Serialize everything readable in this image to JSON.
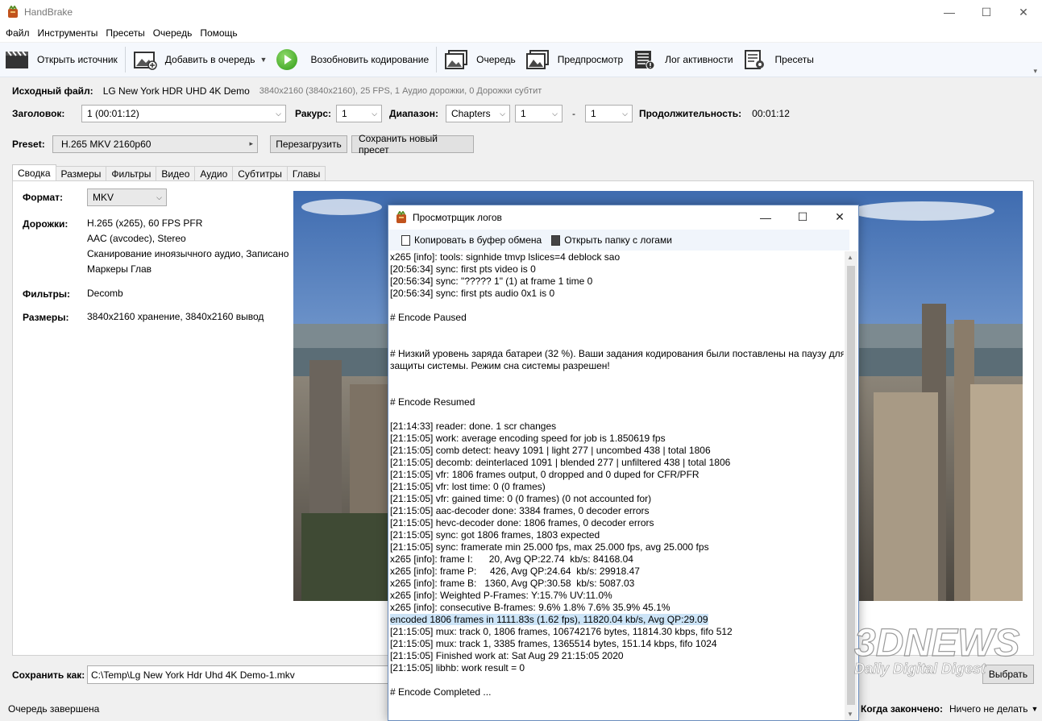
{
  "window": {
    "title": "HandBrake",
    "controls": [
      "—",
      "☐",
      "✕"
    ]
  },
  "menu": [
    "Файл",
    "Инструменты",
    "Пресеты",
    "Очередь",
    "Помощь"
  ],
  "toolbar": {
    "open_source": "Открыть источник",
    "add_queue": "Добавить в очередь",
    "resume": "Возобновить кодирование",
    "queue": "Очередь",
    "preview": "Предпросмотр",
    "activity_log": "Лог активности",
    "presets": "Пресеты"
  },
  "source": {
    "label": "Исходный файл:",
    "name": "LG New York HDR UHD 4K Demo",
    "info": "3840x2160 (3840x2160), 25 FPS, 1 Аудио дорожки, 0 Дорожки субтит"
  },
  "controls": {
    "title_label": "Заголовок:",
    "title_value": "1  (00:01:12)",
    "angle_label": "Ракурс:",
    "angle_value": "1",
    "range_label": "Диапазон:",
    "range_type": "Chapters",
    "range_from": "1",
    "range_dash": "-",
    "range_to": "1",
    "duration_label": "Продолжительность:",
    "duration_value": "00:01:12"
  },
  "preset": {
    "label": "Preset:",
    "value": "H.265 MKV 2160p60",
    "reload": "Перезагрузить",
    "save_new": "Сохранить новый пресет"
  },
  "tabs": [
    "Сводка",
    "Размеры",
    "Фильтры",
    "Видео",
    "Аудио",
    "Субтитры",
    "Главы"
  ],
  "summary": {
    "format_label": "Формат:",
    "format_value": "MKV",
    "tracks_label": "Дорожки:",
    "tracks_lines": [
      "H.265 (x265), 60 FPS PFR",
      "AAC (avcodec), Stereo",
      "Сканирование иноязычного аудио, Записано",
      "Маркеры Глав"
    ],
    "filters_label": "Фильтры:",
    "filters_value": "Decomb",
    "sizes_label": "Размеры:",
    "sizes_value": "3840x2160 хранение, 3840x2160 вывод"
  },
  "save": {
    "label": "Сохранить как:",
    "path": "C:\\Temp\\Lg New York Hdr Uhd 4K Demo-1.mkv",
    "browse": "Выбрать"
  },
  "status": {
    "left": "Очередь завершена",
    "when_done_label": "Когда закончено:",
    "when_done_value": "Ничего не делать"
  },
  "log_window": {
    "title": "Просмотрщик логов",
    "copy": "Копировать в буфер обмена",
    "open_folder": "Открыть папку с логами",
    "lines": [
      "x265 [info]: tools: signhide tmvp lslices=4 deblock sao",
      "[20:56:34] sync: first pts video is 0",
      "[20:56:34] sync: \"????? 1\" (1) at frame 1 time 0",
      "[20:56:34] sync: first pts audio 0x1 is 0",
      "",
      "# Encode Paused",
      "",
      "",
      "# Низкий уровень заряда батареи (32 %). Ваши задания кодирования были поставлены на паузу для",
      "защиты системы. Режим сна системы разрешен!",
      "",
      "",
      "# Encode Resumed",
      "",
      "[21:14:33] reader: done. 1 scr changes",
      "[21:15:05] work: average encoding speed for job is 1.850619 fps",
      "[21:15:05] comb detect: heavy 1091 | light 277 | uncombed 438 | total 1806",
      "[21:15:05] decomb: deinterlaced 1091 | blended 277 | unfiltered 438 | total 1806",
      "[21:15:05] vfr: 1806 frames output, 0 dropped and 0 duped for CFR/PFR",
      "[21:15:05] vfr: lost time: 0 (0 frames)",
      "[21:15:05] vfr: gained time: 0 (0 frames) (0 not accounted for)",
      "[21:15:05] aac-decoder done: 3384 frames, 0 decoder errors",
      "[21:15:05] hevc-decoder done: 1806 frames, 0 decoder errors",
      "[21:15:05] sync: got 1806 frames, 1803 expected",
      "[21:15:05] sync: framerate min 25.000 fps, max 25.000 fps, avg 25.000 fps",
      "x265 [info]: frame I:      20, Avg QP:22.74  kb/s: 84168.04",
      "x265 [info]: frame P:     426, Avg QP:24.64  kb/s: 29918.47",
      "x265 [info]: frame B:   1360, Avg QP:30.58  kb/s: 5087.03",
      "x265 [info]: Weighted P-Frames: Y:15.7% UV:11.0%",
      "x265 [info]: consecutive B-frames: 9.6% 1.8% 7.6% 35.9% 45.1%",
      "encoded 1806 frames in 1111.83s (1.62 fps), 11820.04 kb/s, Avg QP:29.09",
      "[21:15:05] mux: track 0, 1806 frames, 106742176 bytes, 11814.30 kbps, fifo 512",
      "[21:15:05] mux: track 1, 3385 frames, 1365514 bytes, 151.14 kbps, fifo 1024",
      "[21:15:05] Finished work at: Sat Aug 29 21:15:05 2020",
      "[21:15:05] libhb: work result = 0",
      "",
      "# Encode Completed ..."
    ],
    "highlight_index": 30
  },
  "watermark": {
    "logo": "3DNEWS",
    "tagline": "Daily Digital Digest"
  }
}
